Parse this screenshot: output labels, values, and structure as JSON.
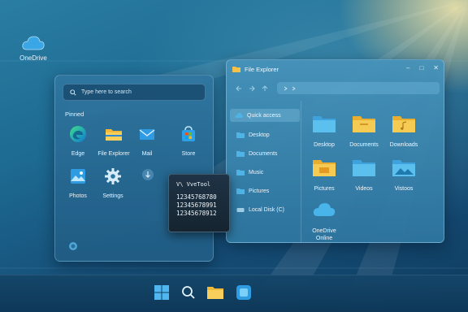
{
  "desktop": {
    "onedrive_label": "OneDrive"
  },
  "start_menu": {
    "search_placeholder": "Type here to search",
    "pinned_label": "Pinned",
    "apps": [
      {
        "label": "Edge"
      },
      {
        "label": "File Explorer"
      },
      {
        "label": "Mail"
      },
      {
        "label": "Store"
      },
      {
        "label": "Photos"
      },
      {
        "label": "Settings"
      }
    ]
  },
  "cmd_window": {
    "title": "V\\ VveTool",
    "lines": [
      "12345768780",
      "12345678991",
      "12345678912"
    ]
  },
  "file_explorer": {
    "title": "File Explorer",
    "sidebar": [
      {
        "label": "Quick access"
      },
      {
        "label": "Desktop"
      },
      {
        "label": "Documents"
      },
      {
        "label": "Music"
      },
      {
        "label": "Pictures"
      },
      {
        "label": "Local Disk (C)"
      }
    ],
    "folders": [
      {
        "label": "Desktop"
      },
      {
        "label": "Documents"
      },
      {
        "label": "Downloads"
      },
      {
        "label": "Pictures"
      },
      {
        "label": "Videos"
      },
      {
        "label": "Vistoos"
      },
      {
        "label": "OneDrive Online"
      }
    ]
  },
  "taskbar": {
    "items": [
      "start-icon",
      "search-icon",
      "file-explorer-icon",
      "store-icon"
    ]
  },
  "colors": {
    "accent": "#3aa0e0",
    "folder_blue": "#4fb3e6",
    "folder_yellow": "#f3c24a"
  }
}
